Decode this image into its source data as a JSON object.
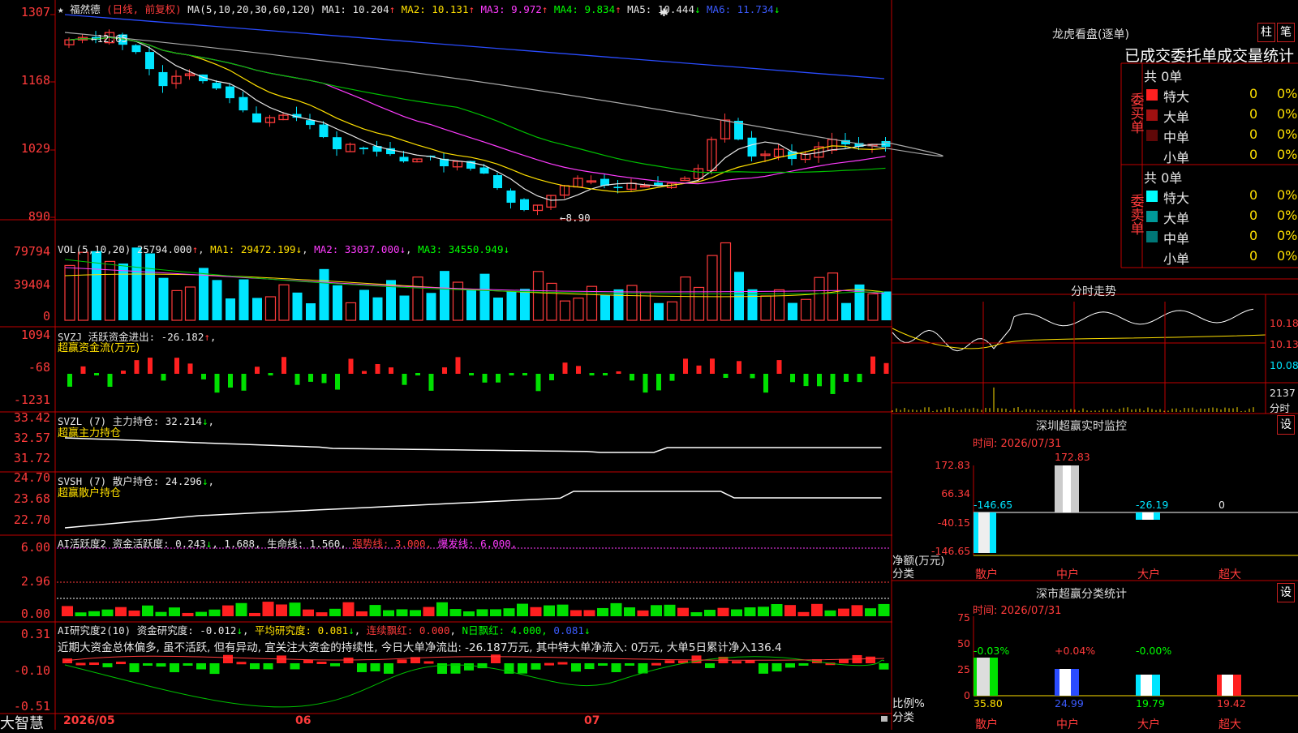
{
  "main": {
    "star": "★",
    "name": "福然德",
    "period": "(日线, 前复权)",
    "ma_params": "MA(5,10,20,30,60,120)",
    "ma": [
      {
        "label": "MA1:",
        "value": "10.204",
        "dir": "↑",
        "color": "#e8e8e8"
      },
      {
        "label": "MA2:",
        "value": "10.131",
        "dir": "↑",
        "color": "#ffe000"
      },
      {
        "label": "MA3:",
        "value": "9.972",
        "dir": "↑",
        "color": "#ff3cff"
      },
      {
        "label": "MA4:",
        "value": "9.834",
        "dir": "↑",
        "color": "#00ff00"
      },
      {
        "label": "MA5:",
        "value": "10.444",
        "dir": "↓",
        "color": "#e8e8e8"
      },
      {
        "label": "MA6:",
        "value": "11.734",
        "dir": "↓",
        "color": "#3b5bff"
      }
    ],
    "axis": [
      "1307",
      "1168",
      "1029",
      "890"
    ],
    "annot_high": "12.65",
    "annot_low": "8.90",
    "marker": "✱"
  },
  "vol": {
    "params": "VOL(5,10,20)",
    "value": "25794.000",
    "ma1": "29472.199",
    "ma2": "33037.000",
    "ma3": "34550.949",
    "axis": [
      "79794",
      "39404",
      "0"
    ]
  },
  "svzj": {
    "line1": "SVZJ  活跃资金进出: -26.182",
    "line1_dir": "↑",
    "line2": "超赢资金流(万元)",
    "axis": [
      "1094",
      "-68",
      "-1231"
    ]
  },
  "svzl": {
    "line1": "SVZL (7) 主力持仓: 32.214",
    "line1_dir": "↓",
    "line2": "超赢主力持仓",
    "axis": [
      "33.42",
      "32.57",
      "31.72"
    ]
  },
  "svsh": {
    "line1": "SVSH (7) 散户持仓: 24.296",
    "line1_dir": "↓",
    "line2": "超赢散户持仓",
    "axis": [
      "24.70",
      "23.68",
      "22.70"
    ]
  },
  "ai1": {
    "title": "AI活跃度2 资金活跃度: 0.243",
    "t_dir": "↓",
    "v2": "1.688",
    "life": "生命线: 1.560,",
    "strong": "强势线: 3.000,",
    "burst": "爆发线: 6.000,",
    "axis": [
      "6.00",
      "2.96",
      "0.00"
    ]
  },
  "ai2": {
    "title": "AI研究度2(10) 资金研究度: -0.012",
    "avg": "平均研究度: 0.081",
    "cont": "连续飘红: 0.000",
    "nday": "N日飘红: 4.000,",
    "last": "0.081",
    "comment": "近期大资金总体偏多, 虽不活跃, 但有异动, 宜关注大资金的持续性, 今日大单净流出: -26.187万元, 其中特大单净流入: 0万元, 大单5日累计净入136.4",
    "axis": [
      "0.31",
      "-0.10",
      "-0.51"
    ]
  },
  "footer": {
    "brand": "大智慧",
    "dates": [
      "2026/05",
      "06",
      "07"
    ]
  },
  "dragon": {
    "title": "龙虎看盘(逐单)",
    "btn1": "柱",
    "btn2": "笔",
    "header": "已成交委托单成交量统计",
    "buy_label": "委买单",
    "sell_label": "委卖单",
    "buy_total": "共 0单",
    "sell_total": "共 0单",
    "buy_rows": [
      {
        "name": "特大",
        "qty": "0",
        "pct": "0%",
        "color": "#ff2020"
      },
      {
        "name": "大单",
        "qty": "0",
        "pct": "0%",
        "color": "#a01010"
      },
      {
        "name": "中单",
        "qty": "0",
        "pct": "0%",
        "color": "#600808"
      },
      {
        "name": "小单",
        "qty": "0",
        "pct": "0%",
        "color": "#000000"
      }
    ],
    "sell_rows": [
      {
        "name": "特大",
        "qty": "0",
        "pct": "0%",
        "color": "#00ffff"
      },
      {
        "name": "大单",
        "qty": "0",
        "pct": "0%",
        "color": "#009999"
      },
      {
        "name": "中单",
        "qty": "0",
        "pct": "0%",
        "color": "#007777"
      },
      {
        "name": "小单",
        "qty": "0",
        "pct": "0%",
        "color": "#000000"
      }
    ]
  },
  "intraday": {
    "title": "分时走势",
    "axis": [
      "10.18",
      "10.13",
      "10.08"
    ],
    "vol": "2137",
    "vol_lbl": "分时"
  },
  "monitor": {
    "title": "深圳超赢实时监控",
    "btn": "设",
    "time": "时间: 2026/07/31",
    "axis": [
      "172.83",
      "66.34",
      "-40.15",
      "-146.65"
    ],
    "ylabel": "净额(万元)",
    "xlabel": "分类",
    "cats": [
      "散户",
      "中户",
      "大户",
      "超大"
    ],
    "values": [
      "-146.65",
      "172.83",
      "-26.19",
      "0"
    ]
  },
  "classify": {
    "title": "深市超赢分类统计",
    "btn": "设",
    "time": "时间: 2026/07/31",
    "axis": [
      "75",
      "50",
      "25",
      "0"
    ],
    "ylabel": "比例%",
    "xlabel": "分类",
    "cats": [
      "散户",
      "中户",
      "大户",
      "超大"
    ],
    "changes": [
      "-0.03%",
      "+0.04%",
      "-0.00%",
      ""
    ],
    "values": [
      "35.80",
      "24.99",
      "19.79",
      "19.42"
    ]
  },
  "colors": {
    "up": "#ff3b3b",
    "down": "#00e5ff",
    "grid": "#c00000"
  }
}
